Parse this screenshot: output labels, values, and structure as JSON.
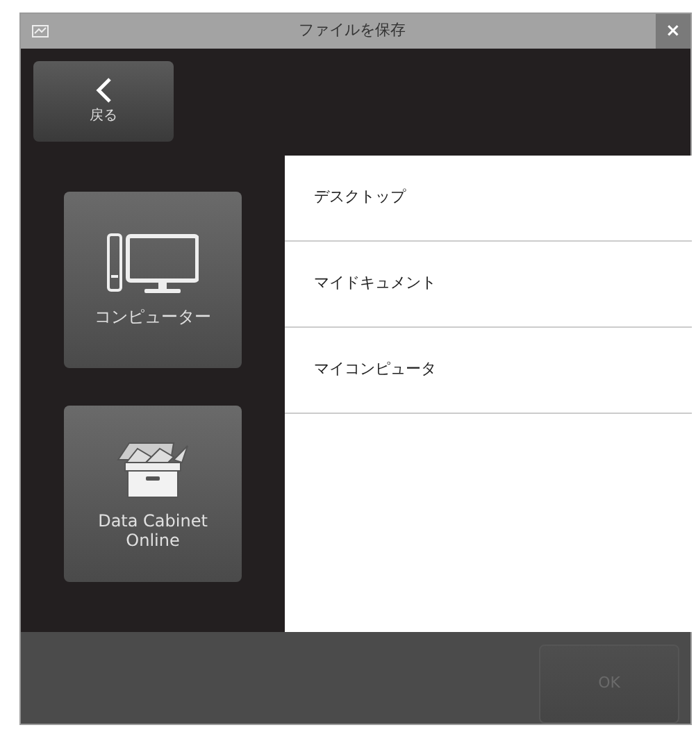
{
  "window": {
    "title": "ファイルを保存",
    "close": "×"
  },
  "back_button": {
    "label": "戻る"
  },
  "locations": [
    {
      "kind": "computer",
      "label": "コンピューター"
    },
    {
      "kind": "cabinet",
      "label": "Data Cabinet Online"
    }
  ],
  "folders": [
    {
      "label": "デスクトップ"
    },
    {
      "label": "マイドキュメント"
    },
    {
      "label": "マイコンピュータ"
    }
  ],
  "ok_button": {
    "label": "OK",
    "disabled": true
  }
}
